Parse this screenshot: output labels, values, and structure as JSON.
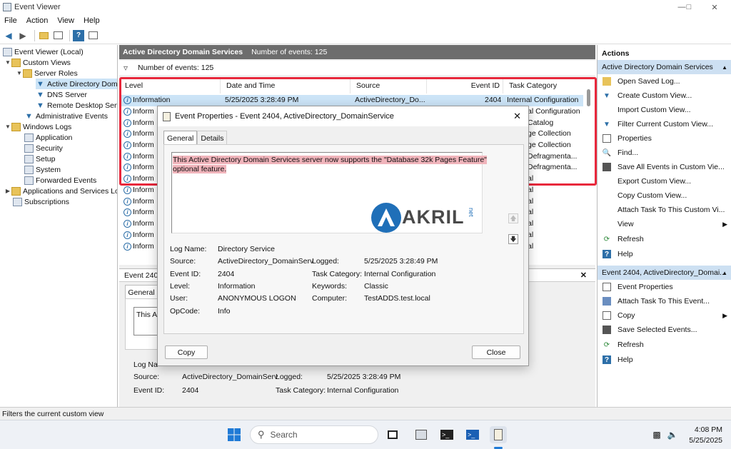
{
  "window": {
    "title": "Event Viewer"
  },
  "menu": [
    "File",
    "Action",
    "View",
    "Help"
  ],
  "tree": {
    "root": "Event Viewer (Local)",
    "custom_views": "Custom Views",
    "server_roles": "Server Roles",
    "ad_ds": "Active Directory Dom",
    "dns": "DNS Server",
    "rds": "Remote Desktop Serv",
    "admin_events": "Administrative Events",
    "windows_logs": "Windows Logs",
    "application": "Application",
    "security": "Security",
    "setup": "Setup",
    "system": "System",
    "forwarded": "Forwarded Events",
    "apps_services": "Applications and Services Lo",
    "subscriptions": "Subscriptions"
  },
  "center": {
    "header_title": "Active Directory Domain Services",
    "header_count": "Number of events: 125",
    "filter_count": "Number of events: 125",
    "columns": [
      "Level",
      "Date and Time",
      "Source",
      "Event ID",
      "Task Category"
    ],
    "rows": [
      {
        "level": "Information",
        "date": "5/25/2025 3:28:49 PM",
        "source": "ActiveDirectory_Do...",
        "id": "2404",
        "cat": "Internal Configuration"
      },
      {
        "level": "Inform",
        "cat": "al Configuration"
      },
      {
        "level": "Inform",
        "cat": "Catalog"
      },
      {
        "level": "Inform",
        "cat": "ge Collection"
      },
      {
        "level": "Inform",
        "cat": "ge Collection"
      },
      {
        "level": "Inform",
        "cat": "Defragmenta..."
      },
      {
        "level": "Inform",
        "cat": "Defragmenta..."
      },
      {
        "level": "Inform",
        "cat": "al"
      },
      {
        "level": "Inform",
        "cat": "al"
      },
      {
        "level": "Inform",
        "cat": "al"
      },
      {
        "level": "Inform",
        "cat": "al"
      },
      {
        "level": "Inform",
        "cat": "al"
      },
      {
        "level": "Inform",
        "cat": "al"
      },
      {
        "level": "Inform",
        "cat": "al"
      }
    ],
    "detail_header": "Event 2404",
    "detail_tab": "General",
    "detail_msg": "This A",
    "detail": {
      "log_name_label": "Log Na",
      "source_label": "Source:",
      "source_value": "ActiveDirectory_DomainServ",
      "logged_label": "Logged:",
      "logged_value": "5/25/2025 3:28:49 PM",
      "event_id_label": "Event ID:",
      "event_id_value": "2404",
      "task_label": "Task Category:",
      "task_value": "Internal Configuration"
    }
  },
  "dialog": {
    "title": "Event Properties - Event 2404, ActiveDirectory_DomainService",
    "tabs": [
      "General",
      "Details"
    ],
    "message_line1": "This Active Directory Domain Services server now supports the \"Database 32k Pages Feature\"",
    "message_line2": "optional feature.",
    "logo_text": "AKRIL",
    "logo_suffix": "net",
    "fields": {
      "log_name_label": "Log Name:",
      "log_name": "Directory Service",
      "source_label": "Source:",
      "source": "ActiveDirectory_DomainServ",
      "logged_label": "Logged:",
      "logged": "5/25/2025 3:28:49 PM",
      "event_id_label": "Event ID:",
      "event_id": "2404",
      "task_label": "Task Category:",
      "task": "Internal Configuration",
      "level_label": "Level:",
      "level": "Information",
      "keywords_label": "Keywords:",
      "keywords": "Classic",
      "user_label": "User:",
      "user": "ANONYMOUS LOGON",
      "computer_label": "Computer:",
      "computer": "TestADDS.test.local",
      "opcode_label": "OpCode:",
      "opcode": "Info"
    },
    "copy_button": "Copy",
    "close_button": "Close"
  },
  "actions": {
    "header": "Actions",
    "section1": "Active Directory Domain Services",
    "items1": [
      "Open Saved Log...",
      "Create Custom View...",
      "Import Custom View...",
      "Filter Current Custom View...",
      "Properties",
      "Find...",
      "Save All Events in Custom Vie...",
      "Export Custom View...",
      "Copy Custom View...",
      "Attach Task To This Custom Vi...",
      "View",
      "Refresh",
      "Help"
    ],
    "section2": "Event 2404, ActiveDirectory_Domai...",
    "items2": [
      "Event Properties",
      "Attach Task To This Event...",
      "Copy",
      "Save Selected Events...",
      "Refresh",
      "Help"
    ]
  },
  "status": "Filters the current custom view",
  "taskbar": {
    "search": "Search",
    "time": "4:08 PM",
    "date": "5/25/2025"
  },
  "colors": {
    "highlight": "#e8283c",
    "selection": "#cce4f7",
    "accent": "#2d6fa8"
  }
}
